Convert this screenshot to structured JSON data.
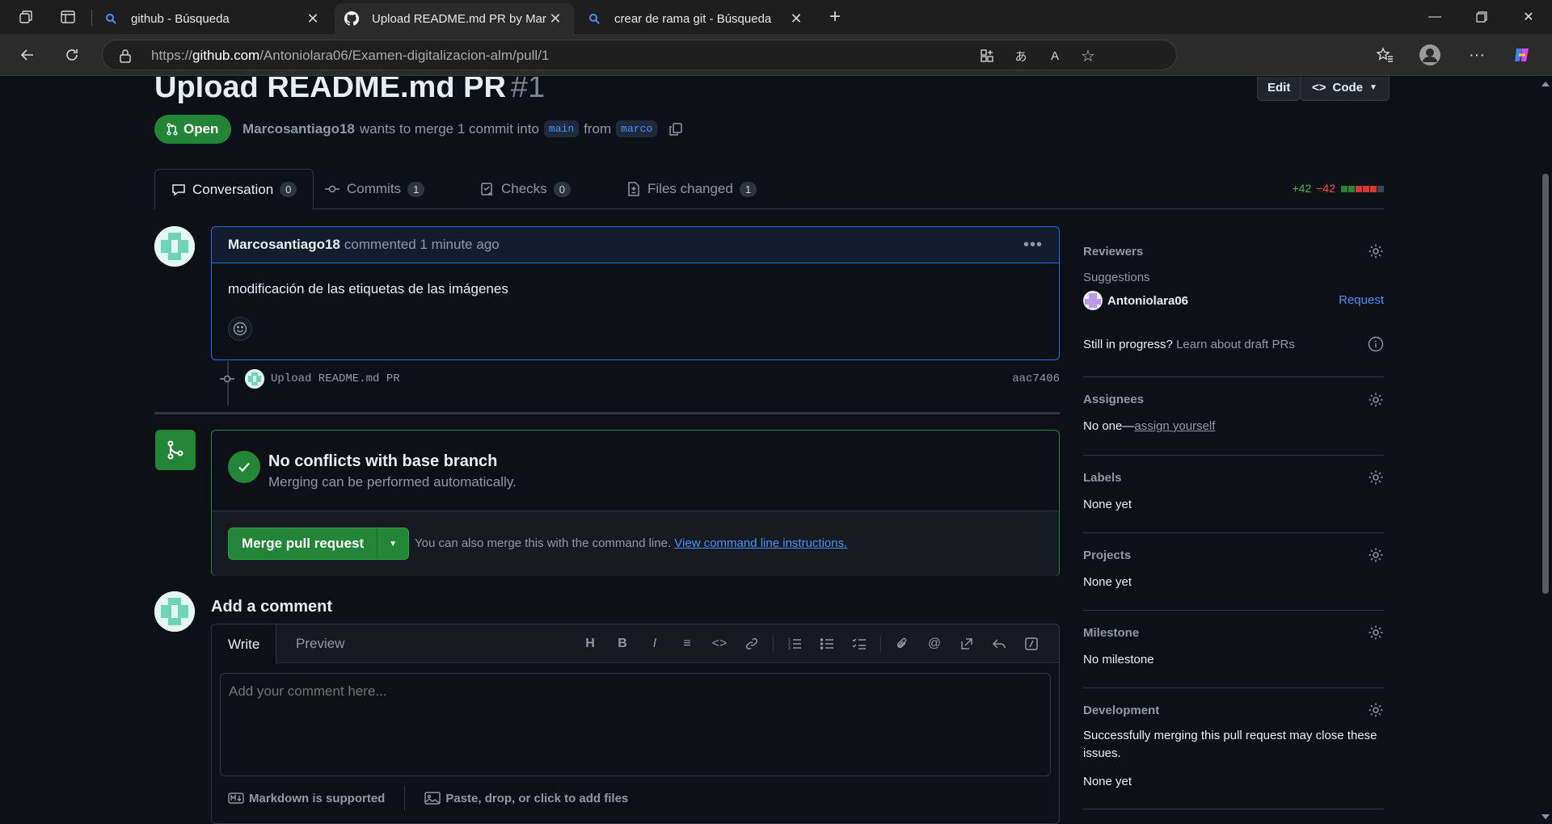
{
  "browser": {
    "tabs": [
      {
        "label": "github - Búsqueda",
        "icon": "search-icon"
      },
      {
        "label": "Upload README.md PR by Marco",
        "icon": "github-icon"
      },
      {
        "label": "crear de rama git - Búsqueda",
        "icon": "search-icon"
      }
    ],
    "url_prefix": "https://",
    "url_host": "github.com",
    "url_path": "/Antoniolara06/Examen-digitalizacion-alm/pull/1"
  },
  "pr": {
    "title": "Upload README.md PR",
    "number": "#1",
    "edit_label": "Edit",
    "code_label": "Code",
    "state": "Open",
    "author": "Marcosantiago18",
    "meta_text": "wants to merge 1 commit into",
    "base_branch": "main",
    "from_text": "from",
    "head_branch": "marco"
  },
  "tabs": [
    {
      "label": "Conversation",
      "count": "0"
    },
    {
      "label": "Commits",
      "count": "1"
    },
    {
      "label": "Checks",
      "count": "0"
    },
    {
      "label": "Files changed",
      "count": "1"
    }
  ],
  "diffstat": {
    "additions": "+42",
    "deletions": "−42",
    "colors": [
      "#238636",
      "#238636",
      "#da3633",
      "#da3633",
      "#da3633",
      "#3d444d"
    ]
  },
  "comment": {
    "author": "Marcosantiago18",
    "action": "commented 1 minute ago",
    "body": "modificación de las etiquetas de las imágenes"
  },
  "commit": {
    "message": "Upload README.md PR",
    "sha": "aac7406"
  },
  "merge": {
    "title": "No conflicts with base branch",
    "subtitle": "Merging can be performed automatically.",
    "button": "Merge pull request",
    "hint": "You can also merge this with the command line.",
    "hint_link": "View command line instructions."
  },
  "add_comment": {
    "title": "Add a comment",
    "write_tab": "Write",
    "preview_tab": "Preview",
    "placeholder": "Add your comment here...",
    "markdown_label": "Markdown is supported",
    "files_label": "Paste, drop, or click to add files"
  },
  "sidebar": {
    "reviewers": {
      "title": "Reviewers",
      "suggestions": "Suggestions",
      "user": "Antoniolara06",
      "request": "Request",
      "draft_q": "Still in progress?",
      "draft_link": "Learn about draft PRs"
    },
    "assignees": {
      "title": "Assignees",
      "none": "No one—",
      "assign_link": "assign yourself"
    },
    "labels": {
      "title": "Labels",
      "value": "None yet"
    },
    "projects": {
      "title": "Projects",
      "value": "None yet"
    },
    "milestone": {
      "title": "Milestone",
      "value": "No milestone"
    },
    "development": {
      "title": "Development",
      "desc_line1": "Successfully merging this pull request may close these",
      "desc_line2": "issues.",
      "value": "None yet"
    }
  }
}
